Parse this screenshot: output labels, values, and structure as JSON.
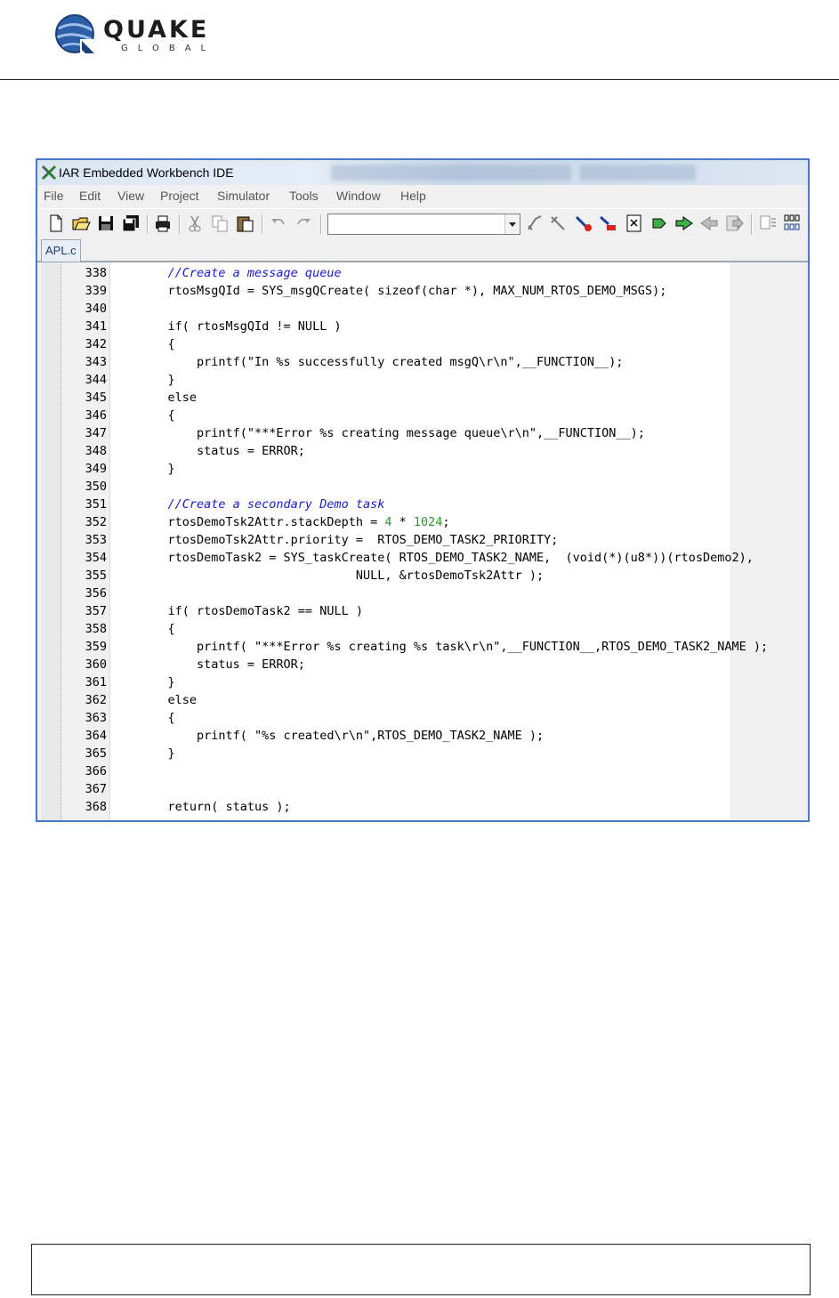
{
  "header": {
    "logo_word": "QUAKE",
    "logo_sub": "GLOBAL",
    "colors": {
      "logo_blue": "#2d5fa8",
      "logo_text": "#1c1c1c"
    }
  },
  "window": {
    "title": "IAR Embedded Workbench IDE",
    "app_icon": "iar-workbench-icon",
    "colors": {
      "frame": "#4a78c8"
    }
  },
  "menu": {
    "items": [
      "File",
      "Edit",
      "View",
      "Project",
      "Simulator",
      "Tools",
      "Window",
      "Help"
    ]
  },
  "toolbar": {
    "icons": [
      "new-file-icon",
      "open-folder-icon",
      "save-icon",
      "save-all-icon",
      "print-icon",
      "cut-icon",
      "copy-icon",
      "paste-icon",
      "undo-icon",
      "redo-icon",
      "find-combo",
      "toggle-bookmark-icon",
      "navigate-icon",
      "toggle-breakpoint-icon",
      "goto-breakpoint-icon",
      "compile-icon",
      "make-icon",
      "download-debug-icon",
      "debug-without-download-icon",
      "stop-icon",
      "step-back-icon",
      "build-options-icon",
      "disassembly-icon"
    ],
    "find_value": ""
  },
  "editor": {
    "tab_label": "APL.c",
    "comment_color": "#1a1ad8",
    "number_color": "#2a9a2a",
    "lines": [
      {
        "num": "338",
        "text": "    //Create a message queue",
        "kind": "comment"
      },
      {
        "num": "339",
        "text": "    rtosMsgQId = SYS_msgQCreate( sizeof(char *), MAX_NUM_RTOS_DEMO_MSGS);",
        "kind": "code"
      },
      {
        "num": "340",
        "text": "",
        "kind": "code"
      },
      {
        "num": "341",
        "text": "    if( rtosMsgQId != NULL )",
        "kind": "code"
      },
      {
        "num": "342",
        "text": "    {",
        "kind": "code"
      },
      {
        "num": "343",
        "text": "        printf(\"In %s successfully created msgQ\\r\\n\",__FUNCTION__);",
        "kind": "code"
      },
      {
        "num": "344",
        "text": "    }",
        "kind": "code"
      },
      {
        "num": "345",
        "text": "    else",
        "kind": "code"
      },
      {
        "num": "346",
        "text": "    {",
        "kind": "code"
      },
      {
        "num": "347",
        "text": "        printf(\"***Error %s creating message queue\\r\\n\",__FUNCTION__);",
        "kind": "code"
      },
      {
        "num": "348",
        "text": "        status = ERROR;",
        "kind": "code"
      },
      {
        "num": "349",
        "text": "    }",
        "kind": "code"
      },
      {
        "num": "350",
        "text": "",
        "kind": "code"
      },
      {
        "num": "351",
        "text": "    //Create a secondary Demo task",
        "kind": "comment"
      },
      {
        "num": "352",
        "text": "    rtosDemoTsk2Attr.stackDepth = 4 * 1024;",
        "kind": "code"
      },
      {
        "num": "353",
        "text": "    rtosDemoTsk2Attr.priority =  RTOS_DEMO_TASK2_PRIORITY;",
        "kind": "code"
      },
      {
        "num": "354",
        "text": "    rtosDemoTask2 = SYS_taskCreate( RTOS_DEMO_TASK2_NAME,  (void(*)(u8*))(rtosDemo2),",
        "kind": "code"
      },
      {
        "num": "355",
        "text": "                              NULL, &rtosDemoTsk2Attr );",
        "kind": "code"
      },
      {
        "num": "356",
        "text": "",
        "kind": "code"
      },
      {
        "num": "357",
        "text": "    if( rtosDemoTask2 == NULL )",
        "kind": "code"
      },
      {
        "num": "358",
        "text": "    {",
        "kind": "code"
      },
      {
        "num": "359",
        "text": "        printf( \"***Error %s creating %s task\\r\\n\",__FUNCTION__,RTOS_DEMO_TASK2_NAME );",
        "kind": "code"
      },
      {
        "num": "360",
        "text": "        status = ERROR;",
        "kind": "code"
      },
      {
        "num": "361",
        "text": "    }",
        "kind": "code"
      },
      {
        "num": "362",
        "text": "    else",
        "kind": "code"
      },
      {
        "num": "363",
        "text": "    {",
        "kind": "code"
      },
      {
        "num": "364",
        "text": "        printf( \"%s created\\r\\n\",RTOS_DEMO_TASK2_NAME );",
        "kind": "code"
      },
      {
        "num": "365",
        "text": "    }",
        "kind": "code"
      },
      {
        "num": "366",
        "text": "",
        "kind": "code"
      },
      {
        "num": "367",
        "text": "",
        "kind": "code"
      },
      {
        "num": "368",
        "text": "    return( status );",
        "kind": "code"
      }
    ]
  }
}
